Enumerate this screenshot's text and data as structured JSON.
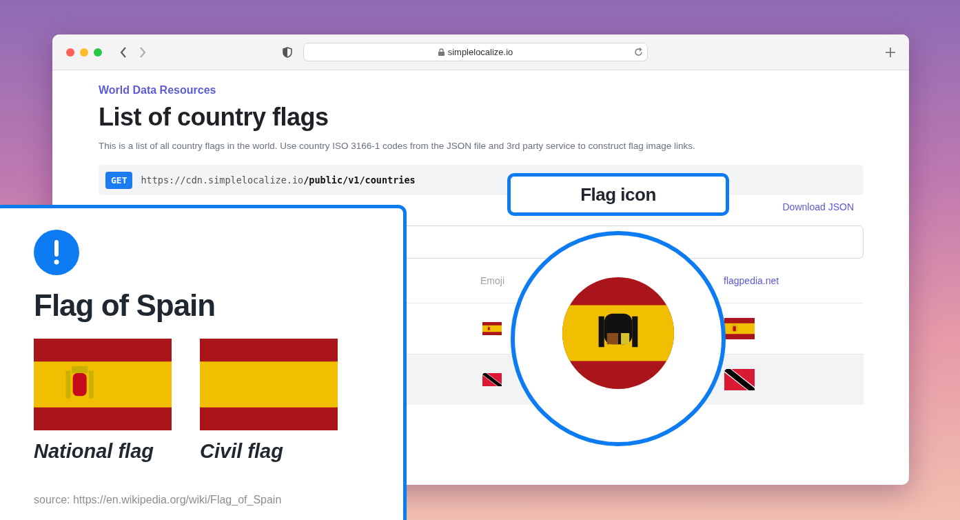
{
  "browser": {
    "address": "simplelocalize.io"
  },
  "page": {
    "breadcrumb": "World Data Resources",
    "title": "List of country flags",
    "description": "This is a list of all country flags in the world. Use country ISO 3166-1 codes from the JSON file and 3rd party service to construct flag image links.",
    "endpoint": {
      "method": "GET",
      "url": "https://cdn.simplelocalize.io**/public/v1/countries**"
    },
    "download_link": "Download JSON",
    "table": {
      "columns": [
        {
          "label": "Emoji",
          "kind": "plain"
        },
        {
          "label": "flagpedia.net",
          "kind": "link"
        }
      ],
      "rows": [
        {
          "kind": "spain",
          "hovered": false
        },
        {
          "kind": "trinidad",
          "hovered": true
        }
      ]
    }
  },
  "callout_label": "Flag icon",
  "info_card": {
    "title": "Flag of Spain",
    "flags": [
      {
        "caption": "National flag",
        "kind": "crest"
      },
      {
        "caption": "Civil flag",
        "kind": "plain"
      }
    ],
    "source": "source: https://en.wikipedia.org/wiki/Flag_of_Spain"
  }
}
